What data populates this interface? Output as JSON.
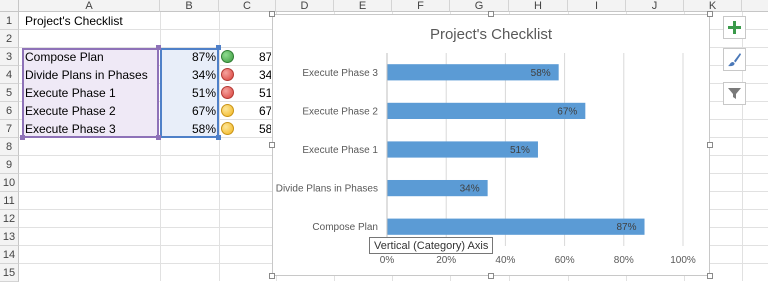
{
  "columns": [
    "A",
    "B",
    "C",
    "D",
    "E",
    "F",
    "G",
    "H",
    "I",
    "J",
    "K"
  ],
  "rows": [
    "1",
    "2",
    "3",
    "4",
    "5",
    "6",
    "7",
    "8",
    "9",
    "10",
    "11",
    "12",
    "13",
    "14",
    "15"
  ],
  "title_cell": "Project's Checklist",
  "tasks": [
    {
      "name": "Compose Plan",
      "percent": "87%",
      "status": "green",
      "c_text": "87"
    },
    {
      "name": "Divide Plans in Phases",
      "percent": "34%",
      "status": "red",
      "c_text": "34"
    },
    {
      "name": "Execute Phase 1",
      "percent": "51%",
      "status": "red",
      "c_text": "51"
    },
    {
      "name": "Execute Phase 2",
      "percent": "67%",
      "status": "yellow",
      "c_text": "67"
    },
    {
      "name": "Execute Phase 3",
      "percent": "58%",
      "status": "yellow",
      "c_text": "58"
    }
  ],
  "colors": {
    "bar": "#5b9bd5",
    "green": "#4caf50",
    "red": "#e8554e",
    "yellow": "#f7c844",
    "plus": "#3a9a4a"
  },
  "side_buttons": [
    {
      "icon": "plus-icon"
    },
    {
      "icon": "brush-icon"
    },
    {
      "icon": "filter-icon"
    }
  ],
  "tooltip": "Vertical (Category) Axis",
  "chart_data": {
    "type": "bar",
    "orientation": "horizontal",
    "title": "Project's Checklist",
    "categories": [
      "Compose Plan",
      "Divide Plans in Phases",
      "Execute Phase 1",
      "Execute Phase 2",
      "Execute Phase 3"
    ],
    "values": [
      87,
      34,
      51,
      67,
      58
    ],
    "data_labels": [
      "87%",
      "34%",
      "51%",
      "67%",
      "58%"
    ],
    "xlim": [
      0,
      100
    ],
    "x_ticks": [
      "0%",
      "20%",
      "40%",
      "60%",
      "80%",
      "100%"
    ],
    "grid": true
  }
}
